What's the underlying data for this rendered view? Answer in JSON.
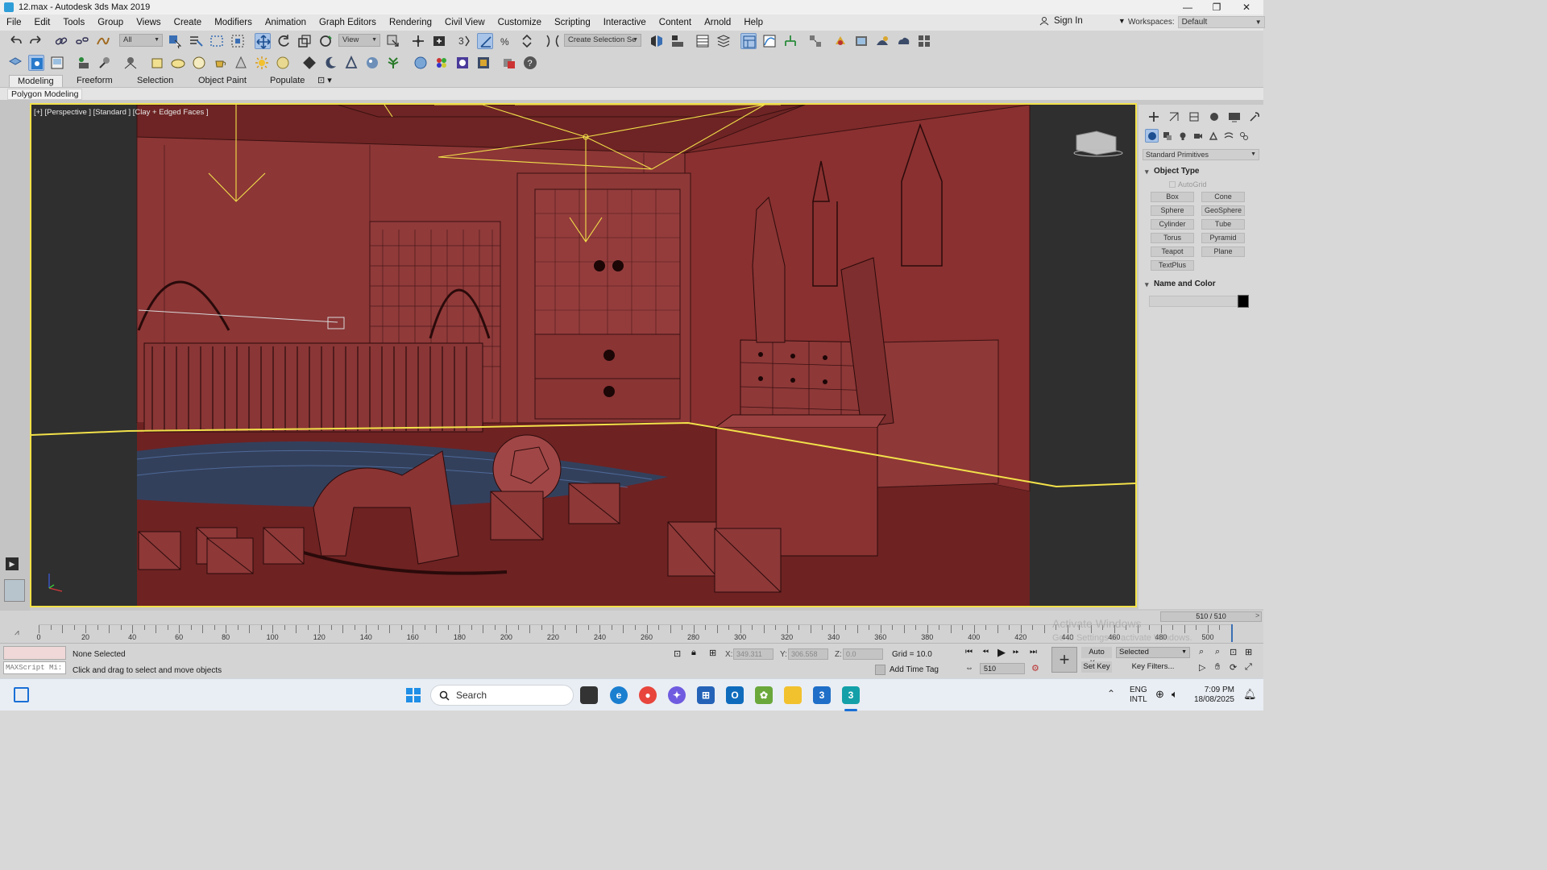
{
  "window": {
    "title": "12.max - Autodesk 3ds Max 2019",
    "controls": {
      "minimize": "—",
      "maximize": "❐",
      "close": "✕"
    }
  },
  "menu": {
    "items": [
      "File",
      "Edit",
      "Tools",
      "Group",
      "Views",
      "Create",
      "Modifiers",
      "Animation",
      "Graph Editors",
      "Rendering",
      "Civil View",
      "Customize",
      "Scripting",
      "Interactive",
      "Content",
      "Arnold",
      "Help"
    ],
    "sign_in": "Sign In",
    "workspaces_label": "Workspaces:",
    "workspace_value": "Default"
  },
  "toolbar": {
    "selection_filter": "All",
    "ref_coord": "View",
    "named_selection": "Create Selection Se"
  },
  "ribbon": {
    "tabs": [
      "Modeling",
      "Freeform",
      "Selection",
      "Object Paint",
      "Populate"
    ],
    "active_tab": "Modeling",
    "panel_label": "Polygon Modeling"
  },
  "viewport": {
    "label": "[+] [Perspective ] [Standard ] [Clay + Edged Faces ]",
    "bg_color": "#7e2a2a",
    "highlight_color": "#f2e14a"
  },
  "command_panel": {
    "category_dropdown": "Standard Primitives",
    "object_type_title": "Object Type",
    "autogrid_label": "AutoGrid",
    "buttons": [
      "Box",
      "Cone",
      "Sphere",
      "GeoSphere",
      "Cylinder",
      "Tube",
      "Torus",
      "Pyramid",
      "Teapot",
      "Plane",
      "TextPlus"
    ],
    "name_color_title": "Name and Color",
    "object_color": "#000000"
  },
  "timeline": {
    "slider_label": "510 / 510",
    "ticks": [
      0,
      20,
      40,
      60,
      80,
      100,
      120,
      140,
      160,
      180,
      200,
      220,
      240,
      260,
      280,
      300,
      320,
      340,
      360,
      380,
      400,
      420,
      440,
      460,
      480,
      500
    ]
  },
  "status": {
    "maxscript_placeholder": "MAXScript Mi:",
    "selection_status": "None Selected",
    "prompt": "Click and drag to select and move objects",
    "x_label": "X:",
    "x_value": "349.311",
    "y_label": "Y:",
    "y_value": "306.558",
    "z_label": "Z:",
    "z_value": "0.0",
    "grid": "Grid = 10.0",
    "add_time_tag": "Add Time Tag",
    "auto_key": "Auto Key",
    "set_key": "Set Key",
    "key_mode": "Selected",
    "key_filters": "Key Filters...",
    "frame": "510"
  },
  "taskbar": {
    "search_placeholder": "Search",
    "lang_top": "ENG",
    "lang_bottom": "INTL",
    "time": "7:09 PM",
    "date": "18/08/2025"
  },
  "watermark": {
    "line1": "Activate Windows",
    "line2": "Go to Settings to activate Windows."
  }
}
